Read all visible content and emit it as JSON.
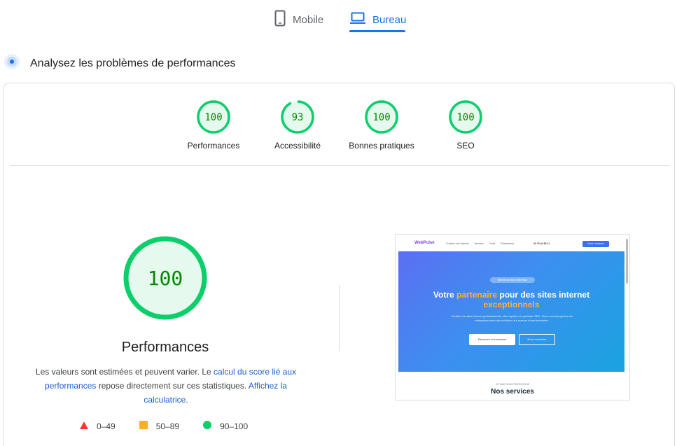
{
  "tabs": {
    "mobile": {
      "label": "Mobile",
      "icon": "smartphone-icon"
    },
    "desktop": {
      "label": "Bureau",
      "icon": "laptop-icon",
      "active": true
    }
  },
  "section": {
    "title": "Analysez les problèmes de performances",
    "icon": "radar-icon"
  },
  "colors": {
    "pass": "#0cce6b",
    "pass_fill": "#e6f9ee",
    "pass_text": "#008800",
    "fail": "#ff3333",
    "average": "#ffaa33",
    "link": "#1a5fc9",
    "accent": "#1a73e8"
  },
  "scores": [
    {
      "label": "Performances",
      "value": 100
    },
    {
      "label": "Accessibilité",
      "value": 93
    },
    {
      "label": "Bonnes pratiques",
      "value": 100
    },
    {
      "label": "SEO",
      "value": 100
    }
  ],
  "main": {
    "score": "100",
    "score_value": 100,
    "label": "Performances",
    "desc_1": "Les valeurs sont estimées et peuvent varier. Le ",
    "link_1": "calcul du score lié aux performances",
    "desc_2": " repose directement sur ces statistiques. ",
    "link_2": "Affichez la calculatrice",
    "desc_3": "."
  },
  "legend": [
    {
      "shape": "triangle",
      "range": "0–49"
    },
    {
      "shape": "square",
      "range": "50–89"
    },
    {
      "shape": "circle",
      "range": "90–100"
    }
  ],
  "preview": {
    "logo": "WebPulse",
    "nav_links": [
      "Création site Internet",
      "Services",
      "Tarifs",
      "Réalisations"
    ],
    "phone": "04 73 44 80 11",
    "cta": "Nous contacter",
    "badge": "Bienvenue chez WebPulse",
    "title_pre": "Votre ",
    "title_hl": "partenaire",
    "title_mid": " pour des sites internet ",
    "title_hl2": "exceptionnels",
    "subtitle": "Création de sites internet professionnels, ultra rapides et optimisés SEO. Nous accompagnons les entreprises avec des solutions sur mesure et performantes.",
    "button_primary": "Découvrir nos services",
    "button_secondary": "Nous contacter",
    "kicker": "CE QUE NOUS PROPOSONS",
    "section_title": "Nos services"
  }
}
